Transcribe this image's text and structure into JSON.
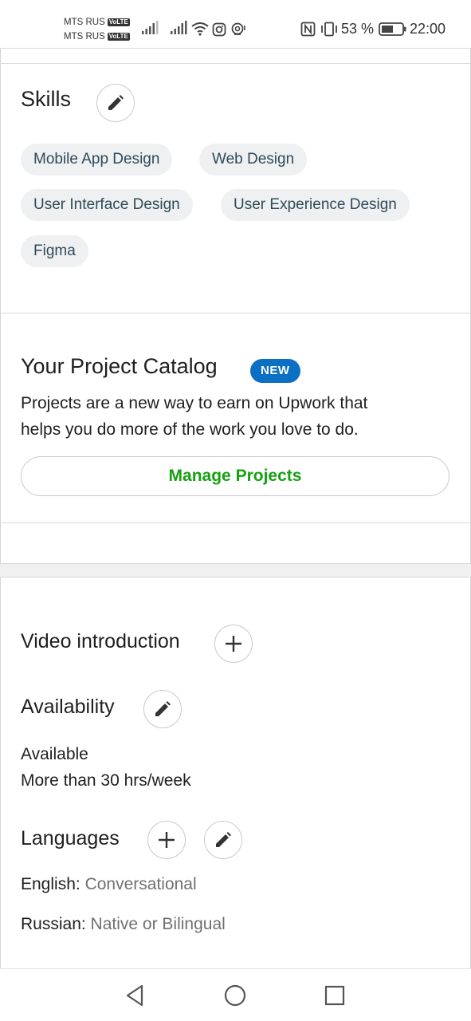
{
  "status_bar": {
    "carrier1": "MTS RUS",
    "carrier2": "MTS RUS",
    "volte_label": "VoLTE",
    "battery": "53 %",
    "time": "22:00"
  },
  "skills": {
    "title": "Skills",
    "items": [
      "Mobile App Design",
      "Web Design",
      "User Interface Design",
      "User Experience Design",
      "Figma"
    ]
  },
  "project_catalog": {
    "title": "Your Project Catalog",
    "badge": "NEW",
    "description_line1": "Projects are a new way to earn on Upwork that",
    "description_line2": "helps you do more of the work you love to do.",
    "button_label": "Manage Projects"
  },
  "video_intro": {
    "title": "Video introduction"
  },
  "availability": {
    "title": "Availability",
    "status": "Available",
    "hours": "More than 30 hrs/week"
  },
  "languages": {
    "title": "Languages",
    "items": [
      {
        "name": "English:",
        "level": "Conversational"
      },
      {
        "name": "Russian:",
        "level": "Native or Bilingual"
      }
    ]
  },
  "colors": {
    "accent_green": "#16a113",
    "badge_blue": "#0b6fc4",
    "chip_bg": "#eef0f1"
  },
  "icons": [
    "nfc-icon",
    "vibrate-icon",
    "battery-icon",
    "wifi-icon",
    "instagram-icon",
    "signal-icon",
    "pencil-icon",
    "plus-icon",
    "back-icon",
    "home-icon",
    "recents-icon"
  ]
}
